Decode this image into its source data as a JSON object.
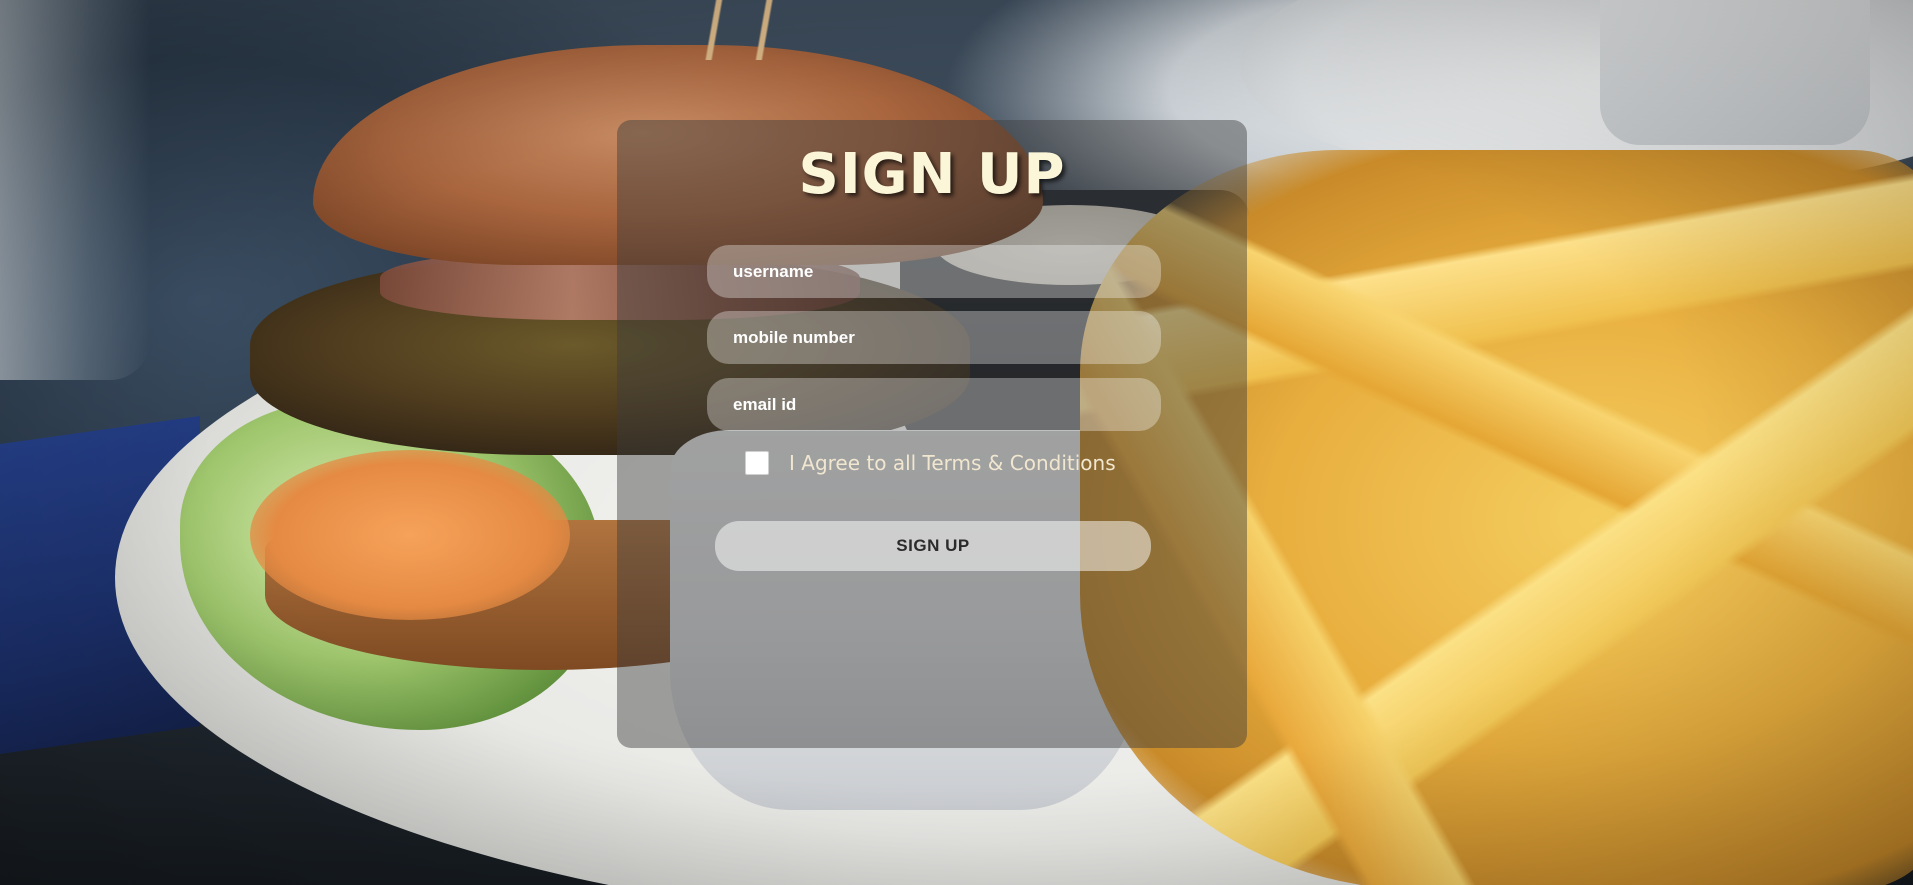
{
  "form": {
    "title": "SIGN UP",
    "username_placeholder": "username",
    "mobile_placeholder": "mobile number",
    "email_placeholder": "email id",
    "agree_label": "I Agree to all Terms & Conditions",
    "agree_checked": false,
    "submit_label": "SIGN UP"
  },
  "colors": {
    "title": "#fcf6d8",
    "panel_overlay": "rgba(60,60,60,0.45)",
    "input_fill": "rgba(255,255,255,0.33)",
    "button_fill": "rgba(255,255,255,0.5)"
  }
}
